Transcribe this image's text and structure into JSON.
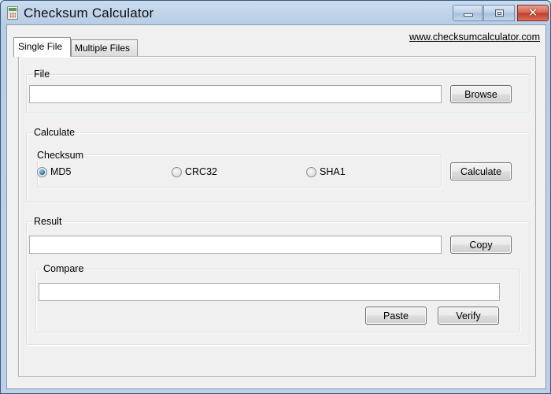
{
  "window": {
    "title": "Checksum Calculator",
    "controls": {
      "minimize": "minimize",
      "maximize": "maximize",
      "close": "close"
    }
  },
  "tabs": [
    {
      "label": "Single File",
      "active": true
    },
    {
      "label": "Multiple Files",
      "active": false
    }
  ],
  "website_link": "www.checksumcalculator.com",
  "file_group": {
    "label": "File",
    "path_value": "",
    "browse_label": "Browse"
  },
  "calculate_group": {
    "label": "Calculate",
    "checksum_label": "Checksum",
    "options": [
      {
        "label": "MD5",
        "checked": true
      },
      {
        "label": "CRC32",
        "checked": false
      },
      {
        "label": "SHA1",
        "checked": false
      }
    ],
    "calculate_label": "Calculate"
  },
  "result_group": {
    "label": "Result",
    "result_value": "",
    "copy_label": "Copy",
    "compare": {
      "label": "Compare",
      "value": "",
      "paste_label": "Paste",
      "verify_label": "Verify"
    }
  }
}
